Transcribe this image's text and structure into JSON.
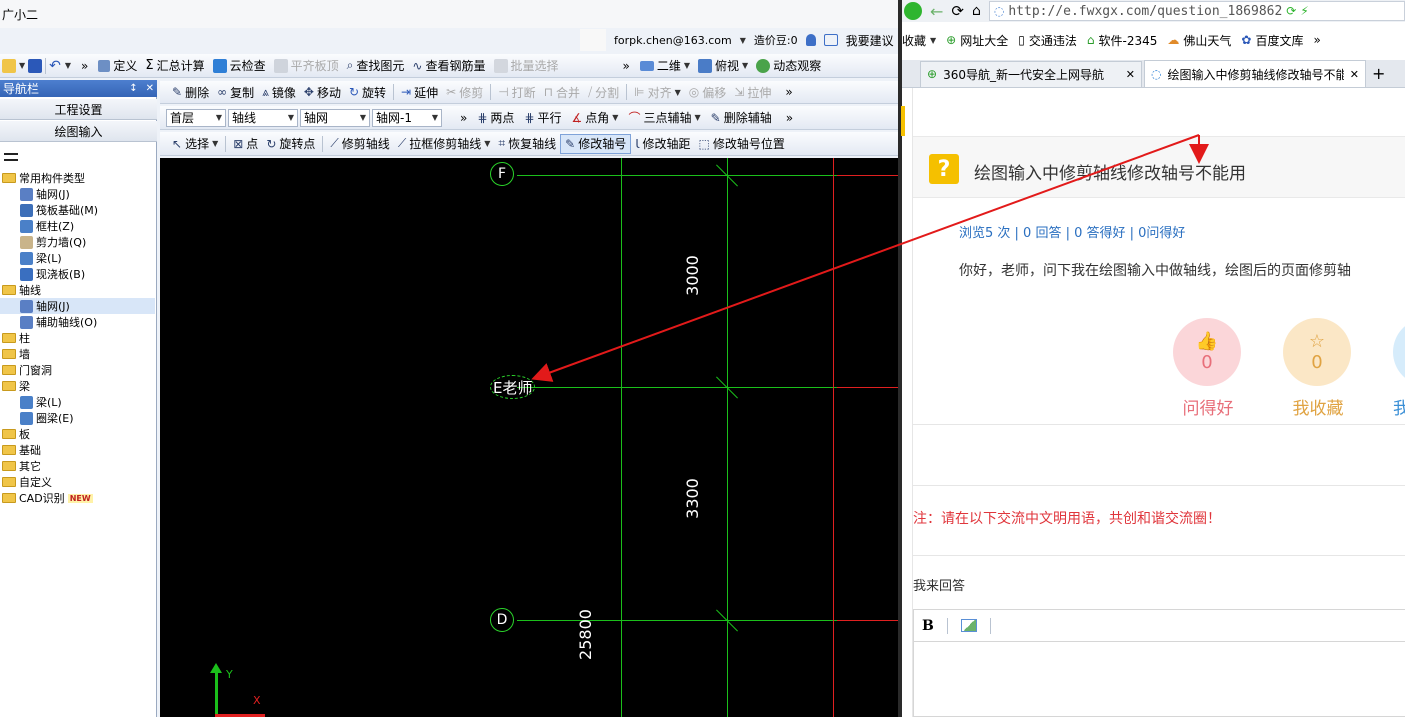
{
  "app": {
    "title": "广小二",
    "account": "forpk.chen@163.com",
    "cost_beans": "造价豆:0",
    "suggest": "我要建议"
  },
  "toolbar1": {
    "items": [
      "定义",
      "汇总计算",
      "云检查",
      "平齐板顶",
      "查找图元",
      "查看钢筋量",
      "批量选择",
      "二维",
      "俯视",
      "动态观察"
    ]
  },
  "toolbar2": {
    "items": [
      "删除",
      "复制",
      "镜像",
      "移动",
      "旋转",
      "延伸",
      "修剪",
      "打断",
      "合并",
      "分割",
      "对齐",
      "偏移",
      "拉伸"
    ]
  },
  "toolbar3": {
    "floor": "首层",
    "type": "轴线",
    "grid": "轴网",
    "grid_name": "轴网-1",
    "items": [
      "两点",
      "平行",
      "点角",
      "三点辅轴",
      "删除辅轴"
    ]
  },
  "toolbar4": {
    "items": [
      "选择",
      "点",
      "旋转点",
      "修剪轴线",
      "拉框修剪轴线",
      "恢复轴线",
      "修改轴号",
      "修改轴距",
      "修改轴号位置"
    ]
  },
  "nav": {
    "title": "导航栏",
    "pin": "↕",
    "close": "✕",
    "btn_project": "工程设置",
    "btn_draw": "绘图输入",
    "tree": [
      {
        "label": "常用构件类型",
        "level": 0,
        "kind": "folder"
      },
      {
        "label": "轴网(J)",
        "level": 1,
        "kind": "grid"
      },
      {
        "label": "筏板基础(M)",
        "level": 1,
        "kind": "raft"
      },
      {
        "label": "框柱(Z)",
        "level": 1,
        "kind": "column"
      },
      {
        "label": "剪力墙(Q)",
        "level": 1,
        "kind": "wall"
      },
      {
        "label": "梁(L)",
        "level": 1,
        "kind": "beam"
      },
      {
        "label": "现浇板(B)",
        "level": 1,
        "kind": "slab"
      },
      {
        "label": "轴线",
        "level": 0,
        "kind": "folder"
      },
      {
        "label": "轴网(J)",
        "level": 1,
        "kind": "grid"
      },
      {
        "label": "辅助轴线(O)",
        "level": 1,
        "kind": "aux"
      },
      {
        "label": "柱",
        "level": 0,
        "kind": "folder"
      },
      {
        "label": "墙",
        "level": 0,
        "kind": "folder"
      },
      {
        "label": "门窗洞",
        "level": 0,
        "kind": "folder"
      },
      {
        "label": "梁",
        "level": 0,
        "kind": "folder"
      },
      {
        "label": "梁(L)",
        "level": 1,
        "kind": "beam"
      },
      {
        "label": "圈梁(E)",
        "level": 1,
        "kind": "beam"
      },
      {
        "label": "板",
        "level": 0,
        "kind": "folder"
      },
      {
        "label": "基础",
        "level": 0,
        "kind": "folder"
      },
      {
        "label": "其它",
        "level": 0,
        "kind": "folder"
      },
      {
        "label": "自定义",
        "level": 0,
        "kind": "folder"
      },
      {
        "label": "CAD识别",
        "level": 0,
        "kind": "folder"
      }
    ],
    "new_badge": "NEW"
  },
  "canvas": {
    "axis_f": "F",
    "axis_e": "E老师",
    "axis_d": "D",
    "dim_3000": "3000",
    "dim_3300": "3300",
    "dim_25800": "25800",
    "y_label": "Y",
    "x_label": "X"
  },
  "browser": {
    "url": "http://e.fwxgx.com/question_1869862",
    "fav_label": "收藏",
    "favorites": [
      "网址大全",
      "交通违法",
      "软件-2345",
      "佛山天气",
      "百度文库"
    ],
    "tabs": [
      "360导航_新一代安全上网导航",
      "绘图输入中修剪轴线修改轴号不能"
    ],
    "question_icon": "?",
    "question_title": "绘图输入中修剪轴线修改轴号不能用",
    "stats": "浏览5 次 | 0 回答 | 0 答得好 | 0问得好",
    "body": "你好，老师，问下我在绘图输入中做轴线，绘图后的页面修剪轴",
    "vote_ask_count": "0",
    "vote_ask_label": "问得好",
    "vote_fav_count": "0",
    "vote_fav_label": "我收藏",
    "vote_third_label": "我",
    "notice": "注：请在以下交流中文明用语，共创和谐交流圈！",
    "answer_label": "我来回答",
    "editor_bold": "B"
  },
  "colors": {
    "canvas_bg": "#000000",
    "grid_green": "#1bbf1b",
    "grid_red": "#e02020",
    "arrow_red": "#e21a1a",
    "notice_red": "#e0363c",
    "link_blue": "#2a6fc0"
  }
}
